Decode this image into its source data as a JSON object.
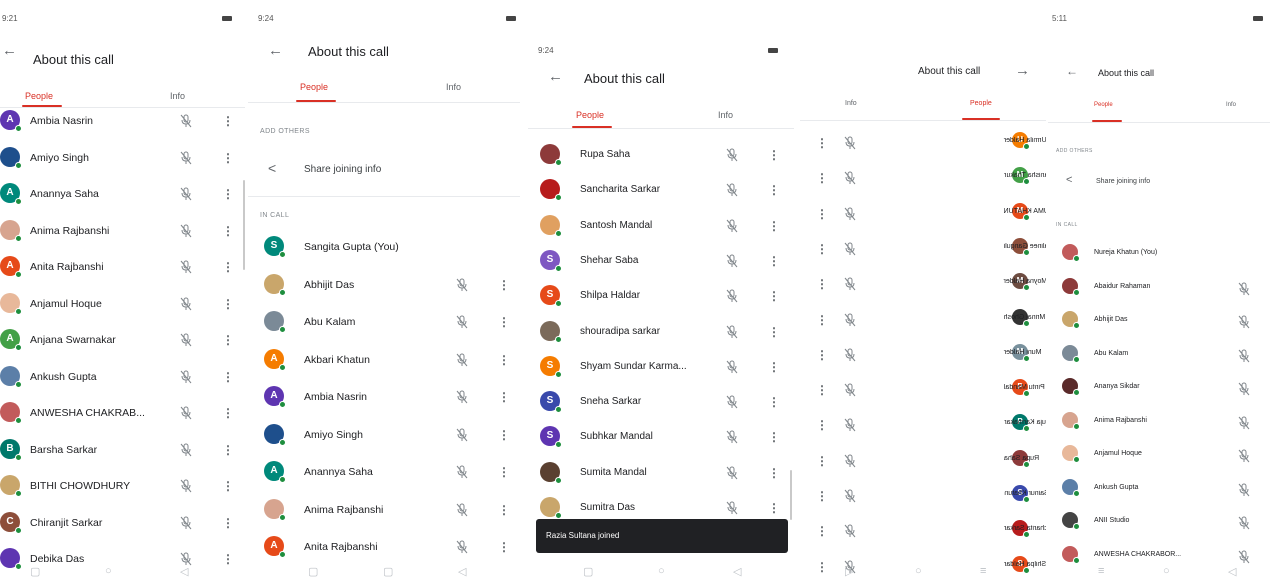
{
  "colors": {
    "accent": "#d93025",
    "online": "#1e8e3e",
    "toast_bg": "#202124"
  },
  "icons": {
    "back": "arrow-left-icon",
    "share": "share-icon",
    "mic_off": "mic-off-icon",
    "more": "more-vert-icon"
  },
  "phone1": {
    "status": "9:21 ",
    "header": {
      "title": "About this call"
    },
    "tabs": {
      "people": "People",
      "info": "Info"
    },
    "participants": [
      {
        "name": "Ambia Nasrin",
        "initial": "A",
        "color": "#5e35b1"
      },
      {
        "name": "Amiyo Singh",
        "initial": "",
        "color": "#1e4f8c"
      },
      {
        "name": "Anannya Saha",
        "initial": "A",
        "color": "#00897b"
      },
      {
        "name": "Anima Rajbanshi",
        "initial": "",
        "color": "#d7a48f"
      },
      {
        "name": "Anita Rajbanshi",
        "initial": "A",
        "color": "#e64a19"
      },
      {
        "name": "Anjamul Hoque",
        "initial": "",
        "color": "#e8b89a"
      },
      {
        "name": "Anjana Swarnakar",
        "initial": "A",
        "color": "#43a047"
      },
      {
        "name": "Ankush Gupta",
        "initial": "",
        "color": "#5c7fa8"
      },
      {
        "name": "ANWESHA CHAKRAB...",
        "initial": "",
        "color": "#c25b5b"
      },
      {
        "name": "Barsha Sarkar",
        "initial": "B",
        "color": "#00796b"
      },
      {
        "name": "BITHI CHOWDHURY",
        "initial": "",
        "color": "#c9a66b"
      },
      {
        "name": "Chiranjit Sarkar",
        "initial": "C",
        "color": "#8d4e3a"
      },
      {
        "name": "Debika Das",
        "initial": "",
        "color": "#5e35b1"
      }
    ]
  },
  "phone2": {
    "status": "9:24 ",
    "header": {
      "title": "About this call"
    },
    "tabs": {
      "people": "People",
      "info": "Info"
    },
    "add_others": "ADD OTHERS",
    "share": "Share joining info",
    "in_call": "IN CALL",
    "participants": [
      {
        "name": "Sangita Gupta (You)",
        "initial": "S",
        "color": "#00897b",
        "self": true
      },
      {
        "name": "Abhijit Das",
        "initial": "",
        "color": "#c9a66b"
      },
      {
        "name": "Abu Kalam",
        "initial": "",
        "color": "#7b8a97"
      },
      {
        "name": "Akbari Khatun",
        "initial": "A",
        "color": "#f57c00"
      },
      {
        "name": "Ambia Nasrin",
        "initial": "A",
        "color": "#5e35b1"
      },
      {
        "name": "Amiyo Singh",
        "initial": "",
        "color": "#1e4f8c"
      },
      {
        "name": "Anannya Saha",
        "initial": "A",
        "color": "#00897b"
      },
      {
        "name": "Anima Rajbanshi",
        "initial": "",
        "color": "#d7a48f"
      },
      {
        "name": "Anita Rajbanshi",
        "initial": "A",
        "color": "#e64a19"
      }
    ]
  },
  "phone3": {
    "status": "9:24 ",
    "header": {
      "title": "About this call"
    },
    "tabs": {
      "people": "People",
      "info": "Info"
    },
    "toast": "Razia Sultana joined",
    "participants": [
      {
        "name": "Rupa Saha",
        "initial": "",
        "color": "#8d3a3a"
      },
      {
        "name": "Sancharita Sarkar",
        "initial": "",
        "color": "#b71c1c"
      },
      {
        "name": "Santosh Mandal",
        "initial": "",
        "color": "#e0a060"
      },
      {
        "name": "Shehar Saba",
        "initial": "S",
        "color": "#7e57c2"
      },
      {
        "name": "Shilpa Haldar",
        "initial": "S",
        "color": "#e64a19"
      },
      {
        "name": "shouradipa sarkar",
        "initial": "",
        "color": "#7b6a5a"
      },
      {
        "name": "Shyam Sundar Karma...",
        "initial": "S",
        "color": "#f57c00"
      },
      {
        "name": "Sneha Sarkar",
        "initial": "S",
        "color": "#3949ab"
      },
      {
        "name": "Subhkar Mandal",
        "initial": "S",
        "color": "#5e35b1"
      },
      {
        "name": "Sumita Mandal",
        "initial": "",
        "color": "#5a4030"
      },
      {
        "name": "Sumitra Das",
        "initial": "",
        "color": "#c9a66b"
      }
    ]
  },
  "phone4": {
    "status": "",
    "header": {
      "title": "About this call"
    },
    "tabs": {
      "people": "People",
      "info": "Info"
    },
    "participants": [
      {
        "name": "Urmila Halder",
        "initial": "U",
        "color": "#f57c00"
      },
      {
        "name": "Manisha Thakur",
        "initial": "M",
        "color": "#43a047"
      },
      {
        "name": "MASUMA KHATUN",
        "initial": "M",
        "color": "#e64a19"
      },
      {
        "name": "Malinee Ganguli",
        "initial": "",
        "color": "#8d4e3a"
      },
      {
        "name": "Moyna Halder",
        "initial": "M",
        "color": "#6d4c41"
      },
      {
        "name": "Mrinal Ghosh",
        "initial": "",
        "color": "#333333"
      },
      {
        "name": "Muni Halder",
        "initial": "M",
        "color": "#78909c"
      },
      {
        "name": "Pintu Mandal",
        "initial": "P",
        "color": "#e64a19"
      },
      {
        "name": "Puja Karmakar",
        "initial": "P",
        "color": "#00796b"
      },
      {
        "name": "Rupa Saha",
        "initial": "",
        "color": "#8d3a3a"
      },
      {
        "name": "Sainur Khatun",
        "initial": "S",
        "color": "#3949ab"
      },
      {
        "name": "Sancharita Sarkar",
        "initial": "",
        "color": "#b71c1c"
      },
      {
        "name": "Shilpa Haldar",
        "initial": "S",
        "color": "#e64a19"
      }
    ]
  },
  "phone5": {
    "status": "5:11",
    "header": {
      "title": "About this call"
    },
    "tabs": {
      "people": "People",
      "info": "Info"
    },
    "add_others": "ADD OTHERS",
    "share": "Share joining info",
    "in_call": "IN CALL",
    "participants": [
      {
        "name": "Nureja Khatun (You)",
        "initial": "",
        "color": "#c25b5b",
        "self": true
      },
      {
        "name": "Abaidur Rahaman",
        "initial": "",
        "color": "#8d3a3a"
      },
      {
        "name": "Abhijit Das",
        "initial": "",
        "color": "#c9a66b"
      },
      {
        "name": "Abu Kalam",
        "initial": "",
        "color": "#7b8a97"
      },
      {
        "name": "Ananya Sikdar",
        "initial": "",
        "color": "#5a2a2a"
      },
      {
        "name": "Anima Rajbanshi",
        "initial": "",
        "color": "#d7a48f"
      },
      {
        "name": "Anjamul Hoque",
        "initial": "",
        "color": "#e8b89a"
      },
      {
        "name": "Ankush Gupta",
        "initial": "",
        "color": "#5c7fa8"
      },
      {
        "name": "ANII Studio",
        "initial": "",
        "color": "#444444"
      },
      {
        "name": "ANWESHA CHAKRABOR...",
        "initial": "",
        "color": "#c25b5b"
      }
    ]
  }
}
